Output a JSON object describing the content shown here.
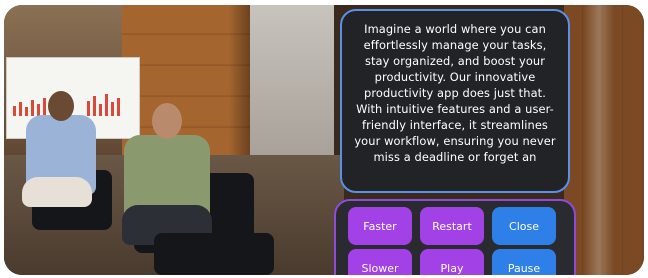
{
  "panel": {
    "text": "Imagine a world where you can effortlessly manage your tasks, stay organized, and boost your productivity. Our innovative productivity app does just that. With intuitive features and a user-friendly interface, it streamlines your workflow, ensuring you never miss a deadline or forget an"
  },
  "controls": {
    "faster": "Faster",
    "restart": "Restart",
    "close": "Close",
    "slower": "Slower",
    "play": "Play",
    "pause": "Pause"
  },
  "colors": {
    "text_panel_border": "#5c8fe6",
    "controls_panel_border": "#8f4bd8",
    "button_purple": "#a241e6",
    "button_blue": "#2f7fe8"
  }
}
